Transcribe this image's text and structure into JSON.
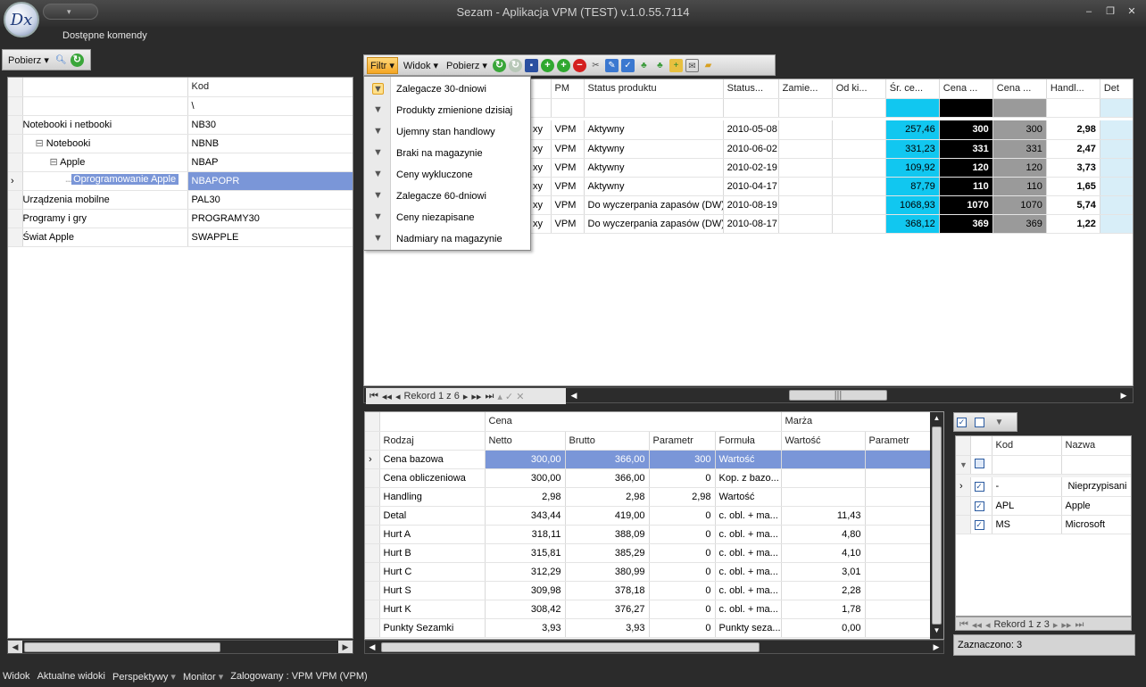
{
  "window": {
    "title": "Sezam - Aplikacja VPM (TEST) v.1.0.55.7114",
    "logo_text": "Dx"
  },
  "cmdbar": {
    "label": "Dostępne komendy"
  },
  "left_toolbar": {
    "pobierz": "Pobierz"
  },
  "tree": {
    "header_kod": "Kod",
    "filter_value": "\\",
    "rows": [
      {
        "name": "Notebooki i netbooki",
        "kod": "NB30"
      },
      {
        "name": "Notebooki",
        "kod": "NBNB"
      },
      {
        "name": "Apple",
        "kod": "NBAP"
      },
      {
        "name": "Oprogramowanie Apple ...",
        "kod": "NBAPOPR"
      },
      {
        "name": "Urządzenia mobilne",
        "kod": "PAL30"
      },
      {
        "name": "Programy i gry",
        "kod": "PROGRAMY30"
      },
      {
        "name": "Świat Apple",
        "kod": "SWAPPLE"
      }
    ]
  },
  "main_toolbar": {
    "filtr": "Filtr",
    "widok": "Widok",
    "pobierz": "Pobierz"
  },
  "filter_menu": [
    "Zalegacze 30-dniowi",
    "Produkty zmienione dzisiaj",
    "Ujemny stan handlowy",
    "Braki na magazynie",
    "Ceny wykluczone",
    "Zalegacze 60-dniowi",
    "Ceny niezapisane",
    "Nadmiary na magazynie"
  ],
  "products": {
    "headers": [
      "PM",
      "Status produktu",
      "Status...",
      "Zamie...",
      "Od ki...",
      "Śr. ce...",
      "Cena ...",
      "Cena ...",
      "Handl...",
      "Det"
    ],
    "rows": [
      {
        "pre": "xy",
        "pm": "VPM",
        "status": "Aktywny",
        "date": "2010-05-08",
        "sr": "257,46",
        "c1": "300",
        "c2": "300",
        "h": "2,98"
      },
      {
        "pre": "xy",
        "pm": "VPM",
        "status": "Aktywny",
        "date": "2010-06-02",
        "sr": "331,23",
        "c1": "331",
        "c2": "331",
        "h": "2,47"
      },
      {
        "pre": "xy",
        "pm": "VPM",
        "status": "Aktywny",
        "date": "2010-02-19",
        "sr": "109,92",
        "c1": "120",
        "c2": "120",
        "h": "3,73"
      },
      {
        "pre": "xy",
        "pm": "VPM",
        "status": "Aktywny",
        "date": "2010-04-17",
        "sr": "87,79",
        "c1": "110",
        "c2": "110",
        "h": "1,65"
      },
      {
        "pre": "xy",
        "pm": "VPM",
        "status": "Do wyczerpania zapasów (DW)",
        "date": "2010-08-19",
        "sr": "1068,93",
        "c1": "1070",
        "c2": "1070",
        "h": "5,74"
      },
      {
        "pre": "xy",
        "pm": "VPM",
        "status": "Do wyczerpania zapasów (DW)",
        "date": "2010-08-17",
        "sr": "368,12",
        "c1": "369",
        "c2": "369",
        "h": "1,22"
      }
    ],
    "record": "Rekord 1 z 6"
  },
  "prices": {
    "group_cena": "Cena",
    "group_marza": "Marża",
    "headers": [
      "Rodzaj",
      "Netto",
      "Brutto",
      "Parametr",
      "Formuła",
      "Wartość",
      "Parametr"
    ],
    "rows": [
      {
        "rodzaj": "Cena bazowa",
        "netto": "300,00",
        "brutto": "366,00",
        "param": "300",
        "formula": "Wartość",
        "wart": ""
      },
      {
        "rodzaj": "Cena obliczeniowa",
        "netto": "300,00",
        "brutto": "366,00",
        "param": "0",
        "formula": "Kop. z bazo...",
        "wart": ""
      },
      {
        "rodzaj": "Handling",
        "netto": "2,98",
        "brutto": "2,98",
        "param": "2,98",
        "formula": "Wartość",
        "wart": ""
      },
      {
        "rodzaj": "Detal",
        "netto": "343,44",
        "brutto": "419,00",
        "param": "0",
        "formula": "c. obl. + ma...",
        "wart": "11,43"
      },
      {
        "rodzaj": "Hurt A",
        "netto": "318,11",
        "brutto": "388,09",
        "param": "0",
        "formula": "c. obl. + ma...",
        "wart": "4,80"
      },
      {
        "rodzaj": "Hurt B",
        "netto": "315,81",
        "brutto": "385,29",
        "param": "0",
        "formula": "c. obl. + ma...",
        "wart": "4,10"
      },
      {
        "rodzaj": "Hurt C",
        "netto": "312,29",
        "brutto": "380,99",
        "param": "0",
        "formula": "c. obl. + ma...",
        "wart": "3,01"
      },
      {
        "rodzaj": "Hurt S",
        "netto": "309,98",
        "brutto": "378,18",
        "param": "0",
        "formula": "c. obl. + ma...",
        "wart": "2,28"
      },
      {
        "rodzaj": "Hurt K",
        "netto": "308,42",
        "brutto": "376,27",
        "param": "0",
        "formula": "c. obl. + ma...",
        "wart": "1,78"
      },
      {
        "rodzaj": "Punkty Sezamki",
        "netto": "3,93",
        "brutto": "3,93",
        "param": "0",
        "formula": "Punkty seza...",
        "wart": "0,00"
      }
    ]
  },
  "brands": {
    "headers": [
      "Kod",
      "Nazwa"
    ],
    "rows": [
      {
        "kod": "-",
        "nazwa": "Nieprzypisani"
      },
      {
        "kod": "APL",
        "nazwa": "Apple"
      },
      {
        "kod": "MS",
        "nazwa": "Microsoft"
      }
    ],
    "record": "Rekord 1 z 3",
    "selected": "Zaznaczono: 3"
  },
  "status_bar": [
    "Widok",
    "Aktualne widoki",
    "Perspektywy",
    "Monitor",
    "Zalogowany : VPM VPM (VPM)"
  ]
}
